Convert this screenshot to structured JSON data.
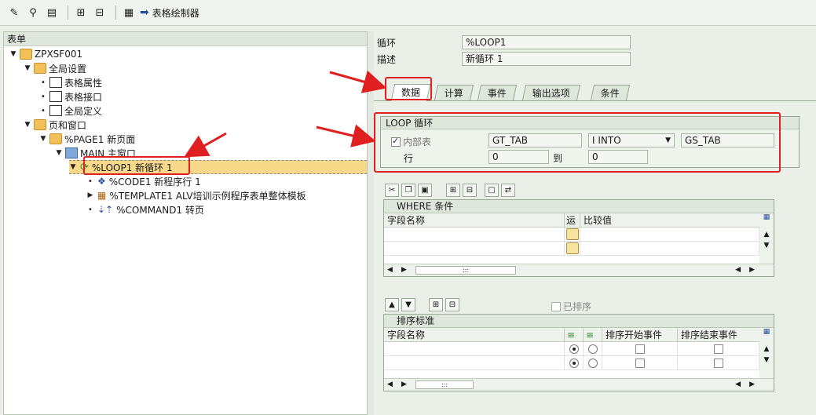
{
  "toolbar": {
    "form_painter_label": "表格绘制器"
  },
  "tree": {
    "header": "表单",
    "root": "ZPXSF001",
    "global": "全局设置",
    "form_attr": "表格属性",
    "form_iface": "表格接口",
    "global_def": "全局定义",
    "pages_windows": "页和窗口",
    "page1": "%PAGE1 新页面",
    "main_window": "MAIN 主窗口",
    "loop1": "%LOOP1 新循环 1",
    "code1": "%CODE1 新程序行 1",
    "template1": "%TEMPLATE1 ALV培训示例程序表单整体模板",
    "command1": "%COMMAND1 转页"
  },
  "node": {
    "loop_label": "循环",
    "loop_value": "%LOOP1",
    "desc_label": "描述",
    "desc_value": "新循环 1"
  },
  "tabs": [
    "数据",
    "计算",
    "事件",
    "输出选项",
    "条件"
  ],
  "loop": {
    "title": "LOOP 循环",
    "internal_table_label": "内部表",
    "table_value": "GT_TAB",
    "into_option": "I INTO",
    "work_area": "GS_TAB",
    "row_label": "行",
    "row_from": "0",
    "to_label": "到",
    "row_to": "0"
  },
  "where": {
    "title": "WHERE 条件",
    "col_field": "字段名称",
    "col_op": "运",
    "col_value": "比较值"
  },
  "sort": {
    "already_sorted_label": "已排序",
    "title": "排序标准",
    "col_field": "字段名称",
    "col_start": "排序开始事件",
    "col_end": "排序结束事件"
  },
  "scroll_grip": ":::"
}
